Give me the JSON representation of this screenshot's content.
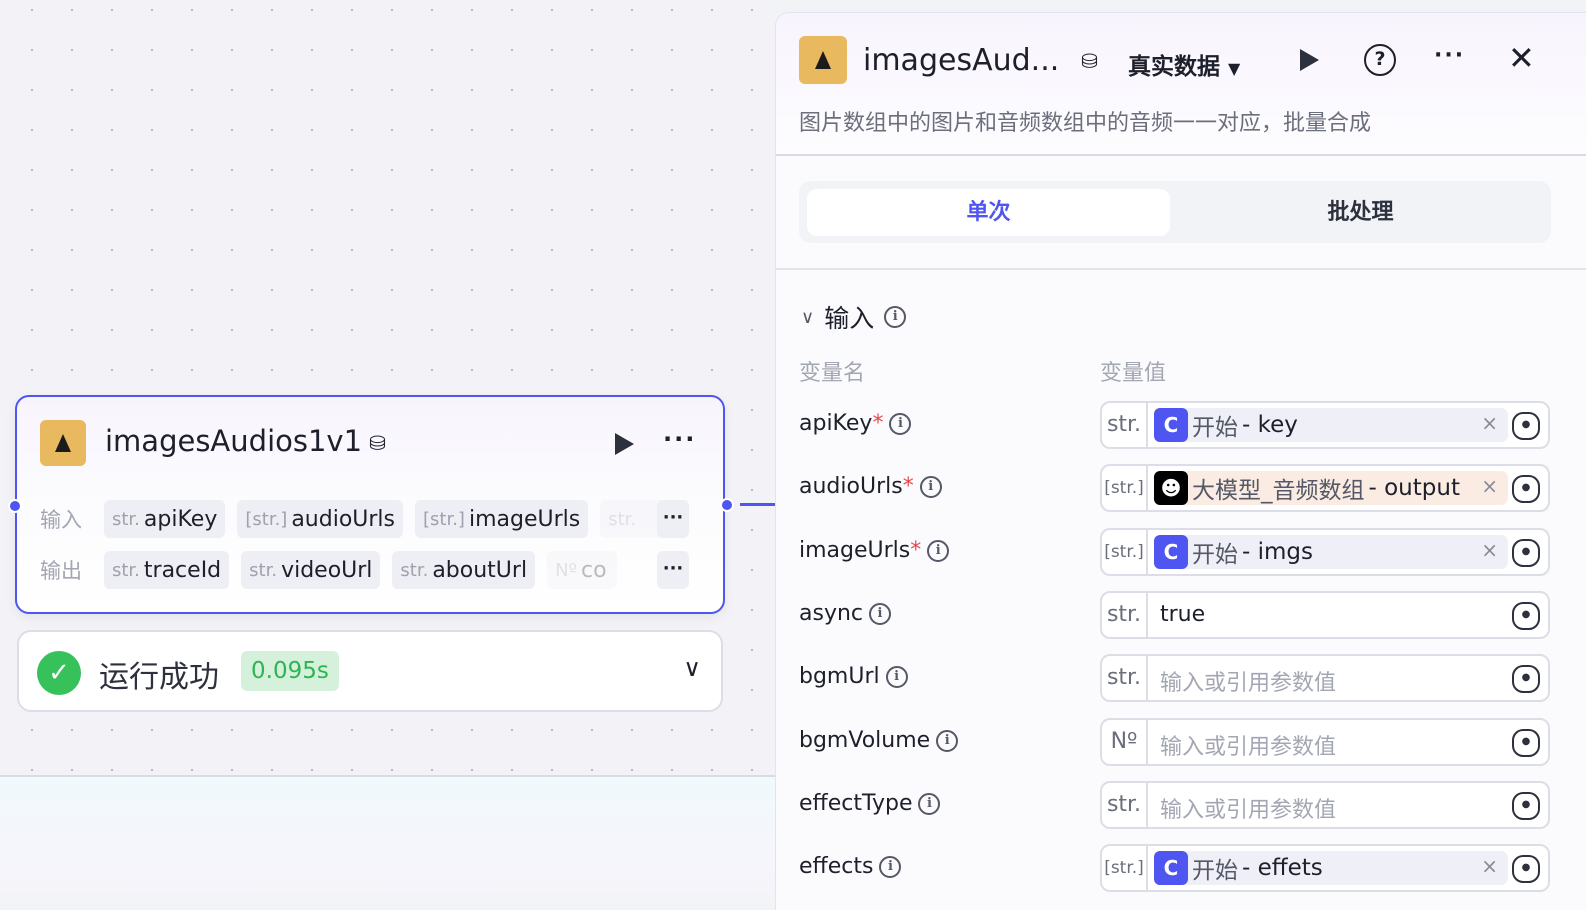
{
  "node": {
    "title": "imagesAudios1v1",
    "input_label": "输入",
    "output_label": "输出",
    "inputs": [
      {
        "type": "str.",
        "name": "apiKey"
      },
      {
        "type": "[str.]",
        "name": "audioUrls"
      },
      {
        "type": "[str.]",
        "name": "imageUrls"
      },
      {
        "type": "str.",
        "name": ""
      }
    ],
    "outputs": [
      {
        "type": "str.",
        "name": "traceId"
      },
      {
        "type": "str.",
        "name": "videoUrl"
      },
      {
        "type": "str.",
        "name": "aboutUrl"
      },
      {
        "type": "Nº",
        "name": "co"
      }
    ],
    "more": "···"
  },
  "result": {
    "status": "运行成功",
    "time": "0.095s"
  },
  "panel": {
    "title": "imagesAud...",
    "data_mode": "真实数据",
    "description": "图片数组中的图片和音频数组中的音频一一对应，批量合成",
    "tabs": [
      "单次",
      "批处理"
    ],
    "section": "输入",
    "col_name": "变量名",
    "col_value": "变量值",
    "rows": [
      {
        "name": "apiKey",
        "required": "*",
        "type": "str.",
        "ref_src": "开始",
        "ref_var": " - key",
        "ref_kind": "start"
      },
      {
        "name": "audioUrls",
        "required": "*",
        "type": "[str.]",
        "ref_src": "大模型_音频数组",
        "ref_var": " - output",
        "ref_kind": "llm"
      },
      {
        "name": "imageUrls",
        "required": "*",
        "type": "[str.]",
        "ref_src": "开始",
        "ref_var": " - imgs",
        "ref_kind": "start"
      },
      {
        "name": "async",
        "type": "str.",
        "value": "true"
      },
      {
        "name": "bgmUrl",
        "type": "str.",
        "placeholder": "输入或引用参数值"
      },
      {
        "name": "bgmVolume",
        "type": "Nº",
        "placeholder": "输入或引用参数值"
      },
      {
        "name": "effectType",
        "type": "str.",
        "placeholder": "输入或引用参数值"
      },
      {
        "name": "effects",
        "type": "[str.]",
        "ref_src": "开始",
        "ref_var": " - effets",
        "ref_kind": "start"
      }
    ]
  },
  "colors": {
    "accent": "#4f55f0",
    "success": "#36c15a",
    "required": "#e5484d"
  }
}
